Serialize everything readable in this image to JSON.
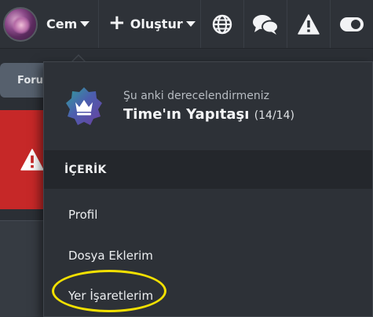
{
  "navbar": {
    "username": "Cem",
    "create_label": "Oluştur",
    "icons": [
      "globe-icon",
      "chat-bubbles-icon",
      "warning-icon",
      "toggle-icon"
    ]
  },
  "background": {
    "forum_tab_label": "Foru"
  },
  "dropdown": {
    "rank_label": "Şu anki derecelendirmeniz",
    "rank_name": "Time'ın Yapıtaşı",
    "rank_count": "(14/14)",
    "section_header": "İÇERİK",
    "items": [
      {
        "label": "Profil"
      },
      {
        "label": "Dosya Eklerim"
      },
      {
        "label": "Yer İşaretlerim"
      }
    ]
  },
  "colors": {
    "navbar_bg": "#2e3238",
    "dropdown_bg": "#2d3137",
    "section_header_bg": "#24272c",
    "alert_red": "#c62828",
    "badge_purple": "#6a3fa0",
    "badge_teal": "#2fa39a",
    "highlight_yellow": "#f2e000"
  }
}
